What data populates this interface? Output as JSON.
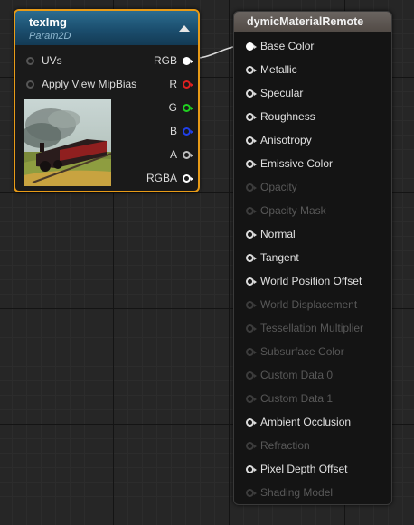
{
  "tex_node": {
    "title": "texImg",
    "subtitle": "Param2D",
    "inputs": [
      {
        "label": "UVs"
      },
      {
        "label": "Apply View MipBias"
      }
    ],
    "outputs": [
      {
        "label": "RGB",
        "color": "#ffffff",
        "connected": true
      },
      {
        "label": "R",
        "color": "#e02020",
        "connected": false
      },
      {
        "label": "G",
        "color": "#20d020",
        "connected": false
      },
      {
        "label": "B",
        "color": "#2040e8",
        "connected": false
      },
      {
        "label": "A",
        "color": "#bfbfbf",
        "connected": false
      },
      {
        "label": "RGBA",
        "color": "#ffffff",
        "connected": false
      }
    ],
    "accent_color": "#e89b17"
  },
  "mat_node": {
    "title": "dymicMaterialRemote",
    "inputs": [
      {
        "label": "Base Color",
        "enabled": true,
        "connected": true
      },
      {
        "label": "Metallic",
        "enabled": true,
        "connected": false
      },
      {
        "label": "Specular",
        "enabled": true,
        "connected": false
      },
      {
        "label": "Roughness",
        "enabled": true,
        "connected": false
      },
      {
        "label": "Anisotropy",
        "enabled": true,
        "connected": false
      },
      {
        "label": "Emissive Color",
        "enabled": true,
        "connected": false
      },
      {
        "label": "Opacity",
        "enabled": false,
        "connected": false
      },
      {
        "label": "Opacity Mask",
        "enabled": false,
        "connected": false
      },
      {
        "label": "Normal",
        "enabled": true,
        "connected": false
      },
      {
        "label": "Tangent",
        "enabled": true,
        "connected": false
      },
      {
        "label": "World Position Offset",
        "enabled": true,
        "connected": false
      },
      {
        "label": "World Displacement",
        "enabled": false,
        "connected": false
      },
      {
        "label": "Tessellation Multiplier",
        "enabled": false,
        "connected": false
      },
      {
        "label": "Subsurface Color",
        "enabled": false,
        "connected": false
      },
      {
        "label": "Custom Data 0",
        "enabled": false,
        "connected": false
      },
      {
        "label": "Custom Data 1",
        "enabled": false,
        "connected": false
      },
      {
        "label": "Ambient Occlusion",
        "enabled": true,
        "connected": false
      },
      {
        "label": "Refraction",
        "enabled": false,
        "connected": false
      },
      {
        "label": "Pixel Depth Offset",
        "enabled": true,
        "connected": false
      },
      {
        "label": "Shading Model",
        "enabled": false,
        "connected": false
      }
    ]
  },
  "icons": {
    "collapse": "collapse-arrow-icon",
    "pin": "pin-circle-icon",
    "preview": "texture-preview-image"
  }
}
